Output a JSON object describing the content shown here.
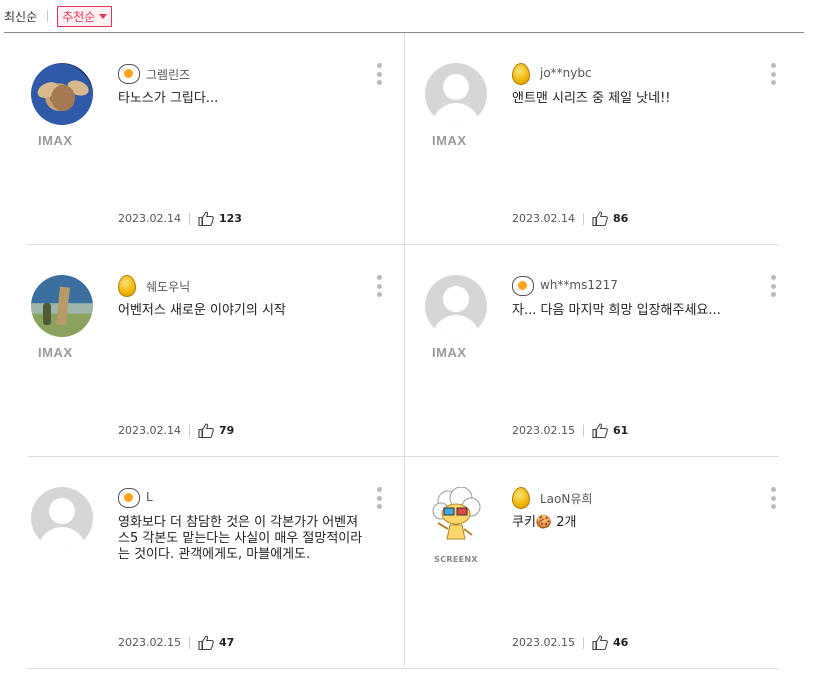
{
  "sort": {
    "latest": "최신순",
    "recommended": "추천순"
  },
  "reviews": [
    {
      "avatar": "gremlin",
      "badge": "IMAX",
      "level_icon": "fried-egg",
      "nickname": "그렘린즈",
      "text": "타노스가 그립다...",
      "date": "2023.02.14",
      "likes": "123"
    },
    {
      "avatar": "default",
      "badge": "IMAX",
      "level_icon": "gold-egg",
      "nickname": "jo**nybc",
      "text": "앤트맨 시리즈 중 제일 낫네!!",
      "date": "2023.02.14",
      "likes": "86"
    },
    {
      "avatar": "dali",
      "badge": "IMAX",
      "level_icon": "gold-egg",
      "nickname": "쉐도우닉",
      "text": "어벤저스 새로운 이야기의 시작",
      "date": "2023.02.14",
      "likes": "79"
    },
    {
      "avatar": "default",
      "badge": "IMAX",
      "level_icon": "fried-egg",
      "nickname": "wh**ms1217",
      "text": "자... 다음 마지막 희망 입장해주세요...",
      "date": "2023.02.15",
      "likes": "61"
    },
    {
      "avatar": "default",
      "badge": "",
      "level_icon": "fried-egg",
      "nickname": "L",
      "text": "영화보다 더 참담한 것은 이 각본가가 어벤져스5 각본도 맡는다는 사실이 매우 절망적이라는 것이다. 관객에게도, 마블에게도.",
      "date": "2023.02.15",
      "likes": "47"
    },
    {
      "avatar": "cartoon",
      "badge": "SCREENX",
      "level_icon": "gold-egg",
      "nickname": "LaoN유희",
      "text": "쿠키🍪 2개",
      "date": "2023.02.15",
      "likes": "46"
    }
  ],
  "colors": {
    "accent": "#e5365a",
    "divider": "#dddddd",
    "badge_gray": "#9a9a9a"
  }
}
